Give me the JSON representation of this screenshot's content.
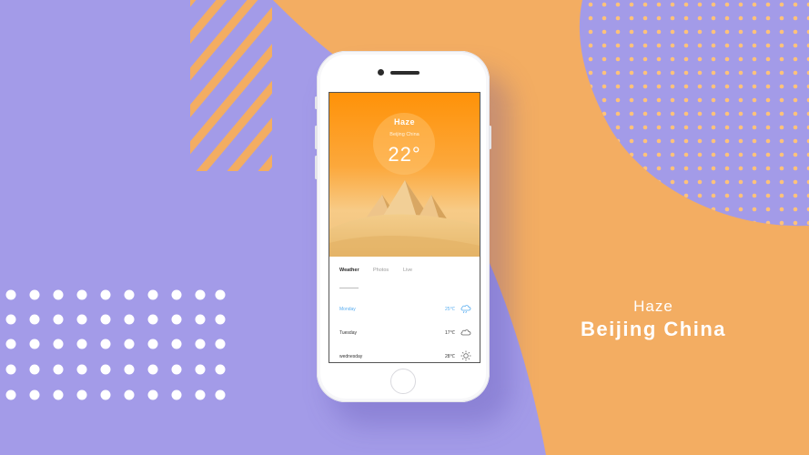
{
  "headline": {
    "condition": "Haze",
    "city": "Beijing China"
  },
  "app": {
    "hero": {
      "condition": "Haze",
      "city": "Beijing China",
      "temperature": "22°"
    },
    "tabs": [
      {
        "label": "Weather",
        "active": true
      },
      {
        "label": "Photos",
        "active": false
      },
      {
        "label": "Live",
        "active": false
      }
    ],
    "forecast": [
      {
        "day": "Monday",
        "temp": "25℃",
        "icon": "rain-cloud-icon"
      },
      {
        "day": "Tuesday",
        "temp": "17℃",
        "icon": "cloud-icon"
      },
      {
        "day": "wednesday",
        "temp": "28℃",
        "icon": "sun-icon"
      }
    ]
  },
  "colors": {
    "background_purple": "#a39be8",
    "background_orange": "#f3ad62",
    "hero_orange": "#ff9208",
    "accent_blue": "#5aaef0"
  }
}
